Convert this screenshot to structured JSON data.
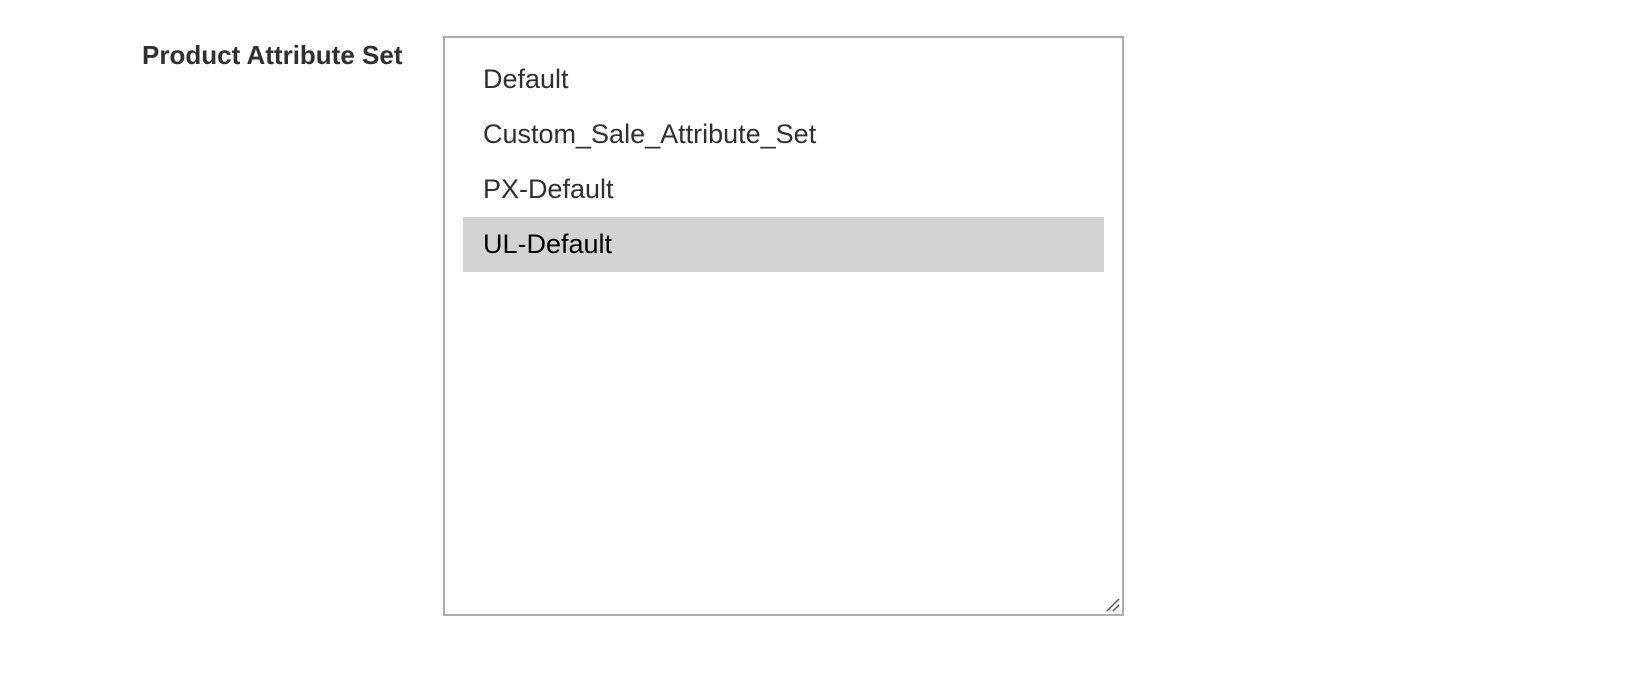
{
  "field": {
    "label": "Product Attribute Set"
  },
  "attribute_set_select": {
    "options": [
      {
        "label": "Default",
        "selected": false
      },
      {
        "label": "Custom_Sale_Attribute_Set",
        "selected": false
      },
      {
        "label": "PX-Default",
        "selected": false
      },
      {
        "label": "UL-Default",
        "selected": true
      }
    ],
    "selected_value": "UL-Default"
  },
  "colors": {
    "selected_background": "#d3d3d3",
    "border": "#adadad",
    "label_text": "#303030"
  },
  "icons": {
    "resize_grip": "resize-grip-icon"
  }
}
